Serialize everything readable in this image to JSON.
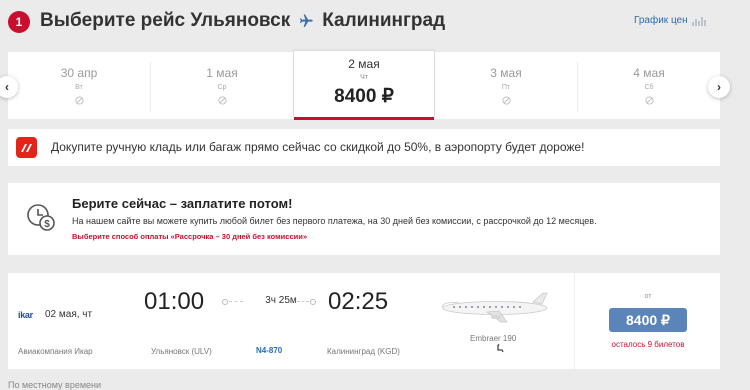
{
  "header": {
    "step": "1",
    "title_prefix": "Выберите рейс Ульяновск",
    "title_suffix": "Калининград",
    "price_chart_link": "График цен"
  },
  "dates": [
    {
      "date": "30 апр",
      "weekday": "Вт",
      "available": false
    },
    {
      "date": "1 мая",
      "weekday": "Ср",
      "available": false
    },
    {
      "date": "2 мая",
      "weekday": "Чт",
      "price": "8400 ₽",
      "selected": true
    },
    {
      "date": "3 мая",
      "weekday": "Пт",
      "available": false
    },
    {
      "date": "4 мая",
      "weekday": "Сб",
      "available": false
    }
  ],
  "promo": {
    "text": "Докупите ручную кладь или багаж прямо сейчас со скидкой до 50%, в аэропорту будет дороже!"
  },
  "bnpl": {
    "heading": "Берите сейчас – заплатите потом!",
    "text": "На нашем сайте вы можете купить любой билет без первого платежа, на 30 дней без комиссии, с рассрочкой до 12 месяцев.",
    "link": "Выберите способ оплаты «Рассрочка – 30 дней без комиссии»"
  },
  "flight": {
    "airline_logo": "ikar",
    "date": "02 мая, чт",
    "airline": "Авиакомпания Икар",
    "departure_time": "01:00",
    "arrival_time": "02:25",
    "duration": "3ч 25м",
    "from": "Ульяновск (ULV)",
    "flight_number": "N4-870",
    "to": "Калининград (KGD)",
    "aircraft": "Embraer 190",
    "price_from_label": "от",
    "price": "8400 ₽",
    "tickets_left": "осталось 9 билетов"
  },
  "footer_note": "По местному времени",
  "colors": {
    "accent": "#c8102e",
    "button": "#5b85b8",
    "link": "#2b6cb0"
  }
}
